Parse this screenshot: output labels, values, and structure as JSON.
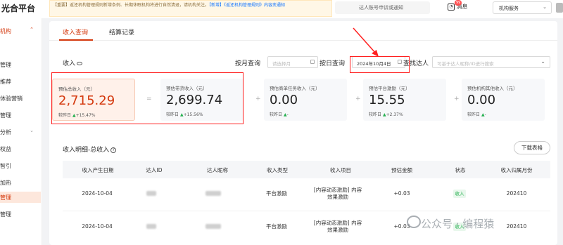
{
  "app": {
    "logo": "光合平台"
  },
  "notice": {
    "prefix": "【重要】",
    "text": "返还机构管理规则新增条例、长期休眠机构将进行自然清退，请机构关注。",
    "new_tag": "【新增】",
    "link": "《返还机构管理规则》内容变通知"
  },
  "header": {
    "search_placeholder": "达人账号申诉或通知",
    "message_label": "消息",
    "message_badge": "99",
    "service_label": "机构服务"
  },
  "sidebar": {
    "items": [
      {
        "label": "机构"
      },
      {
        "label": "管理"
      },
      {
        "label": "推荐"
      },
      {
        "label": "体验营销"
      },
      {
        "label": "管理"
      },
      {
        "label": "分析"
      },
      {
        "label": "权益"
      },
      {
        "label": "智引"
      },
      {
        "label": "加热"
      },
      {
        "label": "管理"
      },
      {
        "label": "管理"
      }
    ]
  },
  "tabs": [
    {
      "label": "收入查询"
    },
    {
      "label": "结算记录"
    }
  ],
  "filters": {
    "revenue_label": "收入",
    "month_label": "按月查询",
    "month_placeholder": "请选择月",
    "day_label": "按日查询",
    "day_value": "2024年10月4日",
    "talent_label": "查找达人",
    "talent_placeholder": "可基于达人昵称/ID进行搜索"
  },
  "cards": [
    {
      "label": "预估总收入（元）",
      "value": "2,715.29",
      "compare_label": "较昨日",
      "compare_value": "+15.47%"
    },
    {
      "label": "预估带货收入（元）",
      "value": "2,699.74",
      "compare_label": "较昨日",
      "compare_value": "+15.56%"
    },
    {
      "label": "预估商单任务收入（元）",
      "value": "0.00",
      "compare_label": "较昨日",
      "compare_value": "-"
    },
    {
      "label": "预估平台激励（元）",
      "value": "15.55",
      "compare_label": "较昨日",
      "compare_value": "+2.37%"
    },
    {
      "label": "预估机构其他收入（元）",
      "value": "0.00",
      "compare_label": "较昨日",
      "compare_value": "-"
    }
  ],
  "operators": [
    "=",
    "+",
    "+",
    "+"
  ],
  "detail": {
    "title": "收入明细-总收入",
    "download_label": "下载表格",
    "columns": [
      "收入产生日期",
      "达人ID",
      "达人昵称",
      "收入类型",
      "收入项目",
      "预估金额",
      "状态",
      "收入归属月份"
    ],
    "rows": [
      {
        "date": "2024-10-04",
        "type": "平台激励",
        "item": "[内容动态激励] 内容效果激励",
        "amount": "+0.03",
        "status": "收入",
        "month": "202410"
      },
      {
        "date": "2024-10-04",
        "type": "平台激励",
        "item": "[内容动态激励] 内容效果激励",
        "amount": "+0.03",
        "status": "收入",
        "month": "202410"
      }
    ]
  },
  "watermark": "公众号 · 编程猿",
  "colors": {
    "accent": "#d4380d",
    "highlight": "#ff2020",
    "up": "#26b050"
  }
}
